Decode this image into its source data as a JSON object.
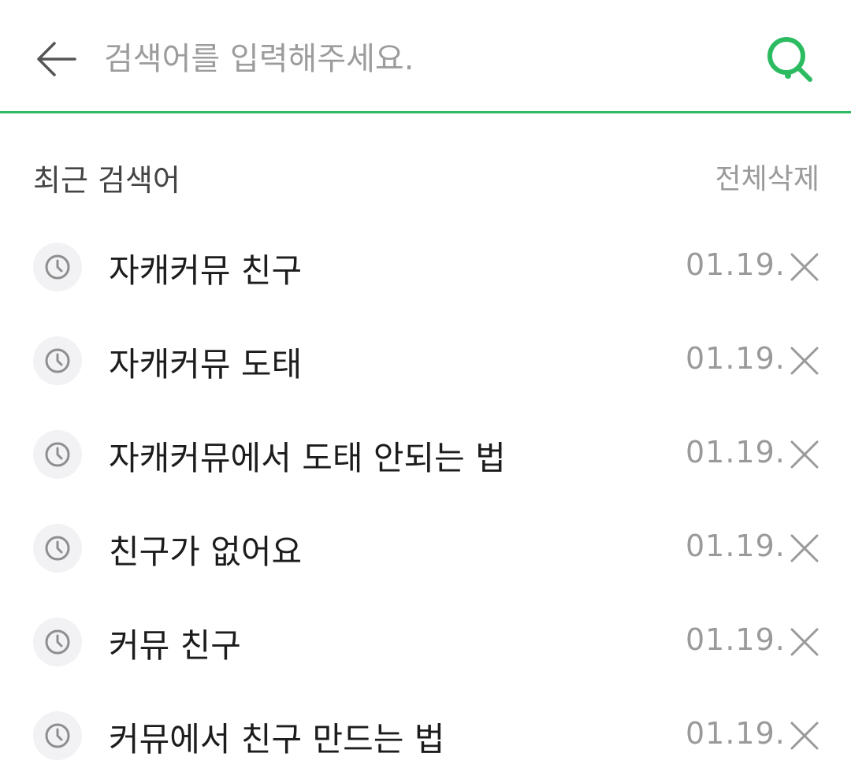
{
  "search": {
    "placeholder": "검색어를 입력해주세요.",
    "value": "",
    "accent_color": "#2dbb62",
    "back_icon": "arrow-left-icon",
    "search_icon": "search-icon"
  },
  "recent": {
    "title": "최근 검색어",
    "clear_all_label": "전체삭제",
    "items": [
      {
        "query": "자캐커뮤 친구",
        "date": "01.19."
      },
      {
        "query": "자캐커뮤 도태",
        "date": "01.19."
      },
      {
        "query": "자캐커뮤에서 도태 안되는 법",
        "date": "01.19."
      },
      {
        "query": "친구가 없어요",
        "date": "01.19."
      },
      {
        "query": "커뮤 친구",
        "date": "01.19."
      },
      {
        "query": "커뮤에서 친구 만드는 법",
        "date": "01.19."
      }
    ],
    "item_icon": "clock-icon",
    "delete_icon": "close-icon"
  }
}
